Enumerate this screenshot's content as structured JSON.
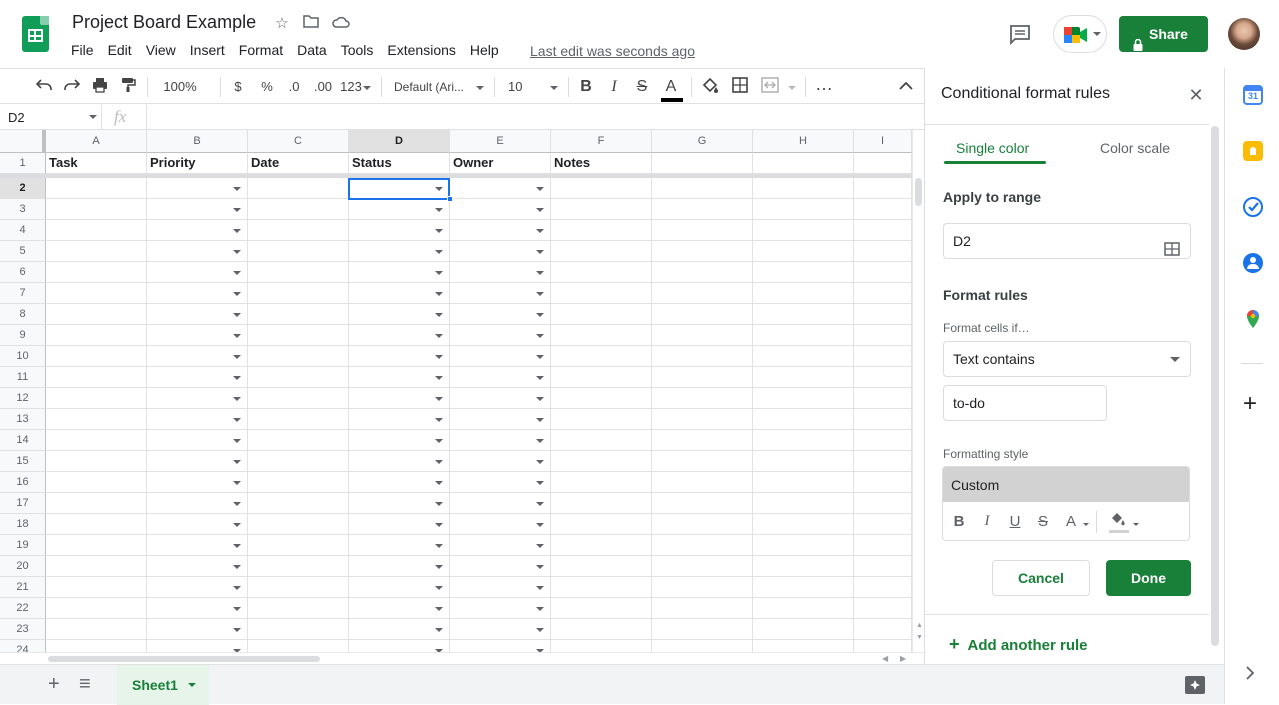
{
  "app": {
    "doc_title": "Project Board Example",
    "last_edit": "Last edit was seconds ago",
    "share_label": "Share",
    "menu": [
      "File",
      "Edit",
      "View",
      "Insert",
      "Format",
      "Data",
      "Tools",
      "Extensions",
      "Help"
    ]
  },
  "toolbar": {
    "zoom": "100%",
    "currency": "$",
    "percent": "%",
    "dec_decrease": ".0",
    "dec_increase": ".00",
    "more_formats": "123",
    "font": "Default (Ari...",
    "font_size": "10",
    "bold": "B",
    "italic": "I",
    "strike": "S",
    "text_color": "A",
    "more": "…"
  },
  "formula_bar": {
    "name_box": "D2",
    "fx": "fx",
    "formula": ""
  },
  "grid": {
    "columns": [
      "A",
      "B",
      "C",
      "D",
      "E",
      "F",
      "G",
      "H",
      "I"
    ],
    "selected_column": "D",
    "header_row": [
      "Task",
      "Priority",
      "Date",
      "Status",
      "Owner",
      "Notes",
      "",
      "",
      ""
    ],
    "rows": [
      "1",
      "2",
      "3",
      "4",
      "5",
      "6",
      "7",
      "8",
      "9",
      "10",
      "11",
      "12",
      "13",
      "14",
      "15",
      "16",
      "17",
      "18",
      "19",
      "20",
      "21",
      "22",
      "23",
      "24"
    ],
    "selected_row": "2",
    "dropdown_columns": [
      "B",
      "D",
      "E"
    ]
  },
  "sheets": {
    "active": "Sheet1",
    "add": "+",
    "list": "≡"
  },
  "panel": {
    "title": "Conditional format rules",
    "tabs": [
      "Single color",
      "Color scale"
    ],
    "apply_to_range_label": "Apply to range",
    "range": "D2",
    "format_rules_label": "Format rules",
    "format_cells_if": "Format cells if…",
    "condition": "Text contains",
    "value": "to-do",
    "formatting_style_label": "Formatting style",
    "style_preview": "Custom",
    "style_buttons": [
      "B",
      "I",
      "U",
      "S",
      "A"
    ],
    "cancel": "Cancel",
    "done": "Done",
    "add_rule": "Add another rule"
  },
  "colors": {
    "accent_green": "#188038",
    "selection_blue": "#1a73e8",
    "preview_gray": "#d2d2d2"
  },
  "icons": [
    "undo-icon",
    "redo-icon",
    "print-icon",
    "paint-format-icon",
    "star-icon",
    "folder-move-icon",
    "cloud-status-icon",
    "comment-icon",
    "meet-icon",
    "lock-icon",
    "bold-icon",
    "italic-icon",
    "strikethrough-icon",
    "text-color-icon",
    "fill-color-icon",
    "borders-icon",
    "merge-icon",
    "collapse-icon",
    "grid-range-icon",
    "close-icon",
    "plus-icon",
    "calendar-icon",
    "keep-icon",
    "tasks-icon",
    "contacts-icon",
    "maps-icon",
    "chevron-right-icon",
    "explore-icon"
  ]
}
